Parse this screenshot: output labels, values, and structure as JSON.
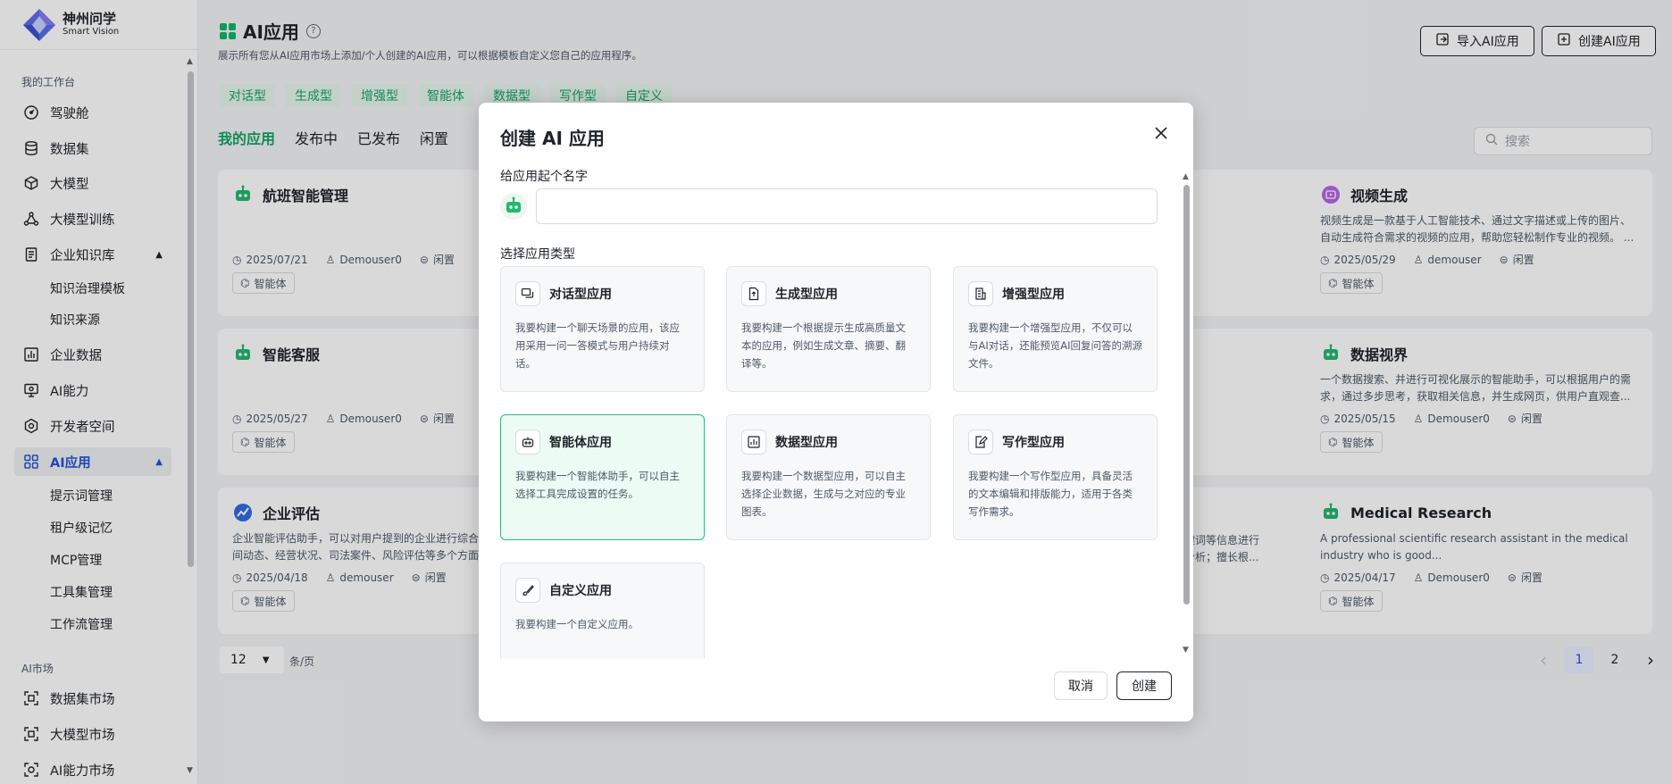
{
  "brand": {
    "name_cn": "神州问学",
    "name_en": "Smart Vision"
  },
  "sidebar": {
    "section_workbench": "我的工作台",
    "items": [
      {
        "label": "驾驶舱"
      },
      {
        "label": "数据集"
      },
      {
        "label": "大模型"
      },
      {
        "label": "大模型训练"
      },
      {
        "label": "企业知识库"
      },
      {
        "label": "知识治理模板"
      },
      {
        "label": "知识来源"
      },
      {
        "label": "企业数据"
      },
      {
        "label": "AI能力"
      },
      {
        "label": "开发者空间"
      },
      {
        "label": "AI应用"
      },
      {
        "label": "提示词管理"
      },
      {
        "label": "租户级记忆"
      },
      {
        "label": "MCP管理"
      },
      {
        "label": "工具集管理"
      },
      {
        "label": "工作流管理"
      }
    ],
    "section_market": "AI市场",
    "market_items": [
      {
        "label": "数据集市场"
      },
      {
        "label": "大模型市场"
      },
      {
        "label": "AI能力市场"
      }
    ]
  },
  "header": {
    "title": "AI应用",
    "subtitle": "展示所有您从AI应用市场上添加/个人创建的AI应用，可以根据模板自定义您自己的应用程序。",
    "import_btn": "导入AI应用",
    "create_btn": "创建AI应用"
  },
  "chips": [
    "对话型",
    "生成型",
    "增强型",
    "智能体",
    "数据型",
    "写作型",
    "自定义"
  ],
  "tabs": [
    "我的应用",
    "发布中",
    "已发布",
    "闲置"
  ],
  "search": {
    "placeholder": "搜索"
  },
  "cards": [
    {
      "name": "航班智能管理",
      "desc": "",
      "date": "2025/07/21",
      "user": "Demouser0",
      "status": "闲置",
      "tag": "智能体"
    },
    {
      "name": "智能客服",
      "desc": "",
      "date": "2025/05/27",
      "user": "Demouser0",
      "status": "闲置",
      "tag": "智能体"
    },
    {
      "name": "企业评估",
      "desc": "企业智能评估助手，可以对用户提到的企业进行综合",
      "desc2": "间动态、经营状况、司法案件、风险评估等多个方面",
      "date": "2025/04/18",
      "user": "demouser",
      "status": "闲置",
      "tag": "智能体"
    },
    {
      "name": "视频生成",
      "desc": "视频生成是一款基于人工智能技术、通过文字描述或上传的图片、自动生成符合需求的视频的应用，帮助您轻松制作专业的视频。 ...",
      "date": "2025/05/29",
      "user": "demouser",
      "status": "闲置",
      "tag": "智能体"
    },
    {
      "name": "数据视界",
      "desc": "一个数据搜索、并进行可视化展示的智能助手，可以根据用户的需求，通过多步思考，获取相关信息，并生成网页，供用户直观查...",
      "date": "2025/05/15",
      "user": "Demouser0",
      "status": "闲置",
      "tag": "智能体"
    },
    {
      "name": "Medical Research",
      "desc": "A professional scientific research assistant in the medical industry who is good...",
      "date": "2025/04/17",
      "user": "Demouser0",
      "status": "闲置",
      "tag": "智能体"
    }
  ],
  "partial_desc": {
    "line1": "键词等信息进行",
    "line2": "分析；擅长根..."
  },
  "pagination": {
    "page_size": "12",
    "per_page_label": "条/页",
    "pages": [
      "1",
      "2"
    ],
    "prev": "‹",
    "next": "›"
  },
  "modal": {
    "title": "创建 AI 应用",
    "name_label": "给应用起个名字",
    "name_value": "",
    "type_label": "选择应用类型",
    "types": [
      {
        "name": "对话型应用",
        "desc": "我要构建一个聊天场景的应用，该应用采用一问一答模式与用户持续对话。"
      },
      {
        "name": "生成型应用",
        "desc": "我要构建一个根据提示生成高质量文本的应用，例如生成文章、摘要、翻译等。"
      },
      {
        "name": "增强型应用",
        "desc": "我要构建一个增强型应用，不仅可以与AI对话，还能预览AI回复问答的溯源文件。"
      },
      {
        "name": "智能体应用",
        "desc": "我要构建一个智能体助手，可以自主选择工具完成设置的任务。"
      },
      {
        "name": "数据型应用",
        "desc": "我要构建一个数据型应用，可以自主选择企业数据，生成与之对应的专业图表。"
      },
      {
        "name": "写作型应用",
        "desc": "我要构建一个写作型应用，具备灵活的文本编辑和排版能力，适用于各类写作需求。"
      },
      {
        "name": "自定义应用",
        "desc": "我要构建一个自定义应用。"
      }
    ],
    "selected_type": "智能体应用",
    "cancel": "取消",
    "create": "创建"
  },
  "colors": {
    "accent_green": "#15a566",
    "active_blue": "#2553d6",
    "chip_bg": "#e5f6ee"
  }
}
